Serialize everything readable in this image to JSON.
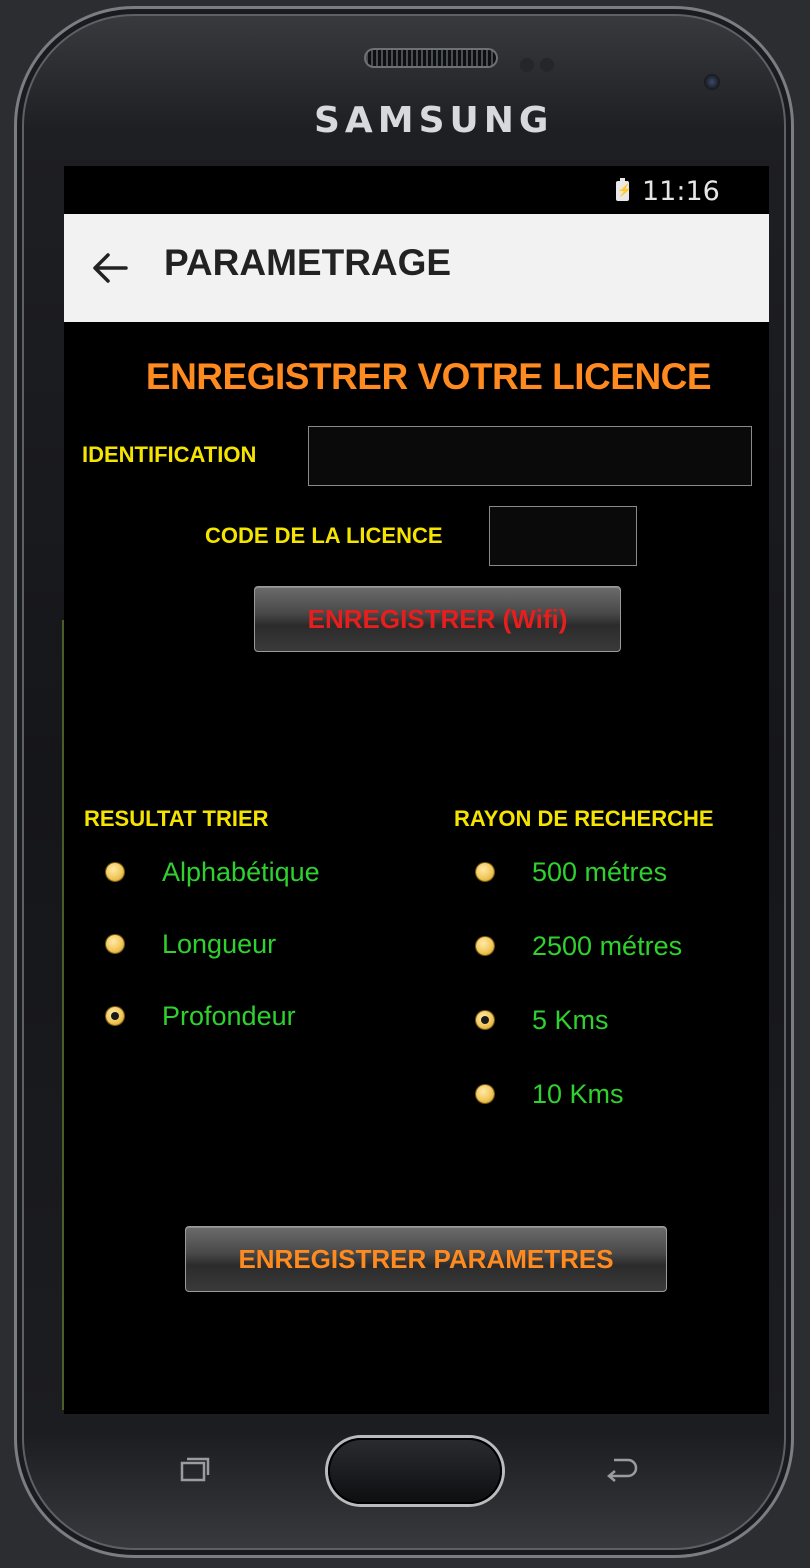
{
  "device": {
    "brand": "SAMSUNG"
  },
  "status_bar": {
    "time": "11:16"
  },
  "app_bar": {
    "title": "PARAMETRAGE",
    "back_icon": "arrow-left-icon"
  },
  "license": {
    "heading": "ENREGISTRER VOTRE LICENCE",
    "identification_label": "IDENTIFICATION",
    "identification_value": "",
    "code_label": "CODE DE LA LICENCE",
    "code_value": "",
    "register_button": "ENREGISTRER (Wifi)"
  },
  "sort": {
    "label": "RESULTAT TRIER",
    "options": [
      {
        "label": "Alphabétique",
        "checked": false
      },
      {
        "label": "Longueur",
        "checked": false
      },
      {
        "label": "Profondeur",
        "checked": true
      }
    ]
  },
  "radius": {
    "label": "RAYON DE RECHERCHE",
    "options": [
      {
        "label": "500 métres",
        "checked": false
      },
      {
        "label": "2500 métres",
        "checked": false
      },
      {
        "label": "5 Kms",
        "checked": true
      },
      {
        "label": "10 Kms",
        "checked": false
      }
    ]
  },
  "save_button": "ENREGISTRER  PARAMETRES",
  "colors": {
    "heading": "#ff8a1f",
    "label": "#f5e400",
    "option": "#2fd12f",
    "wifi_button_text": "#e61e1e",
    "save_button_text": "#ff8a1f"
  }
}
